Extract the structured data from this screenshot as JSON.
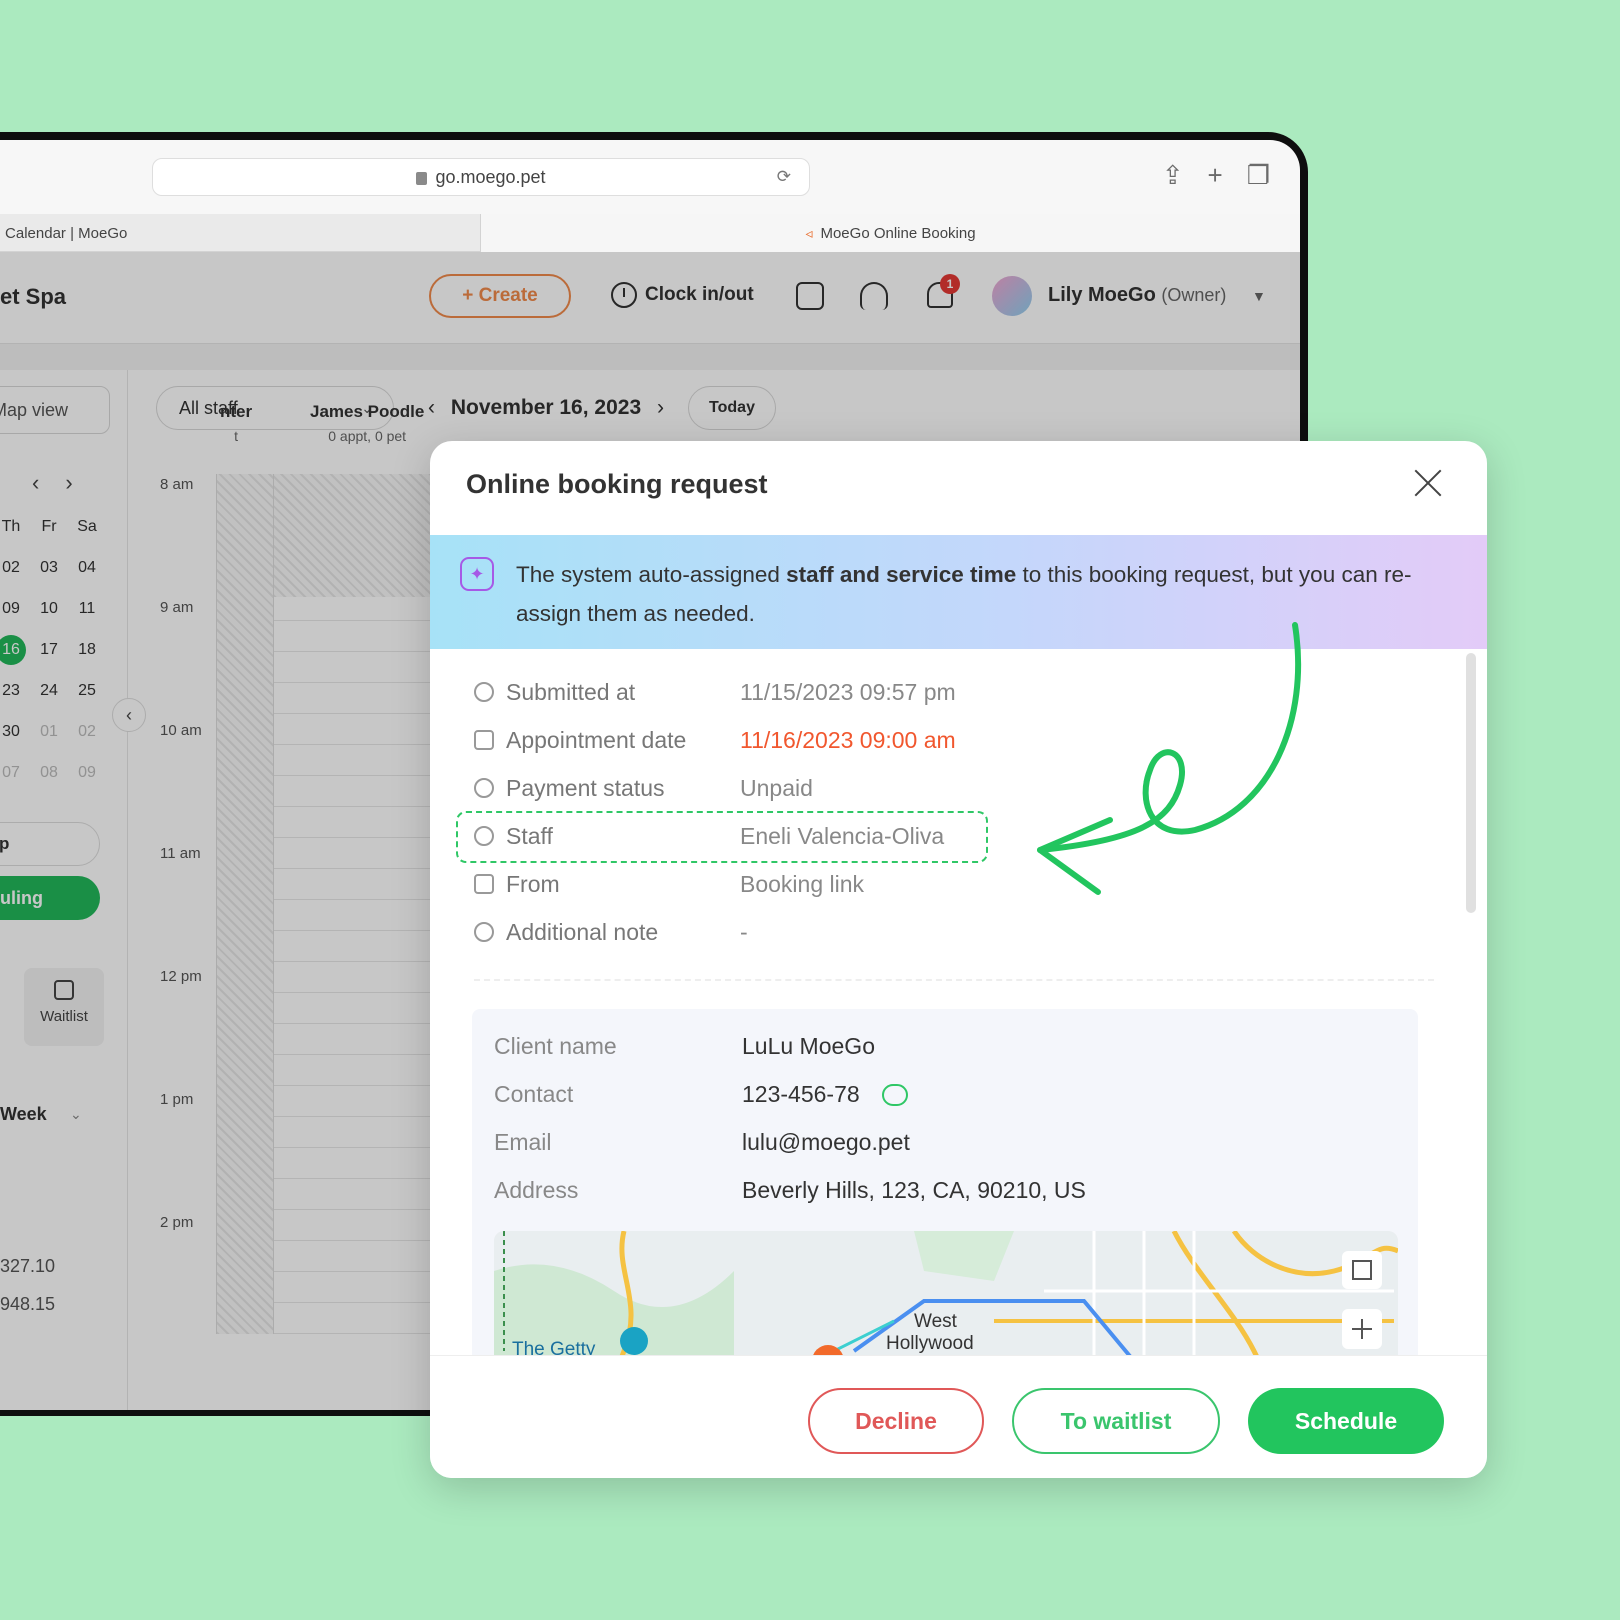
{
  "browser": {
    "url": "go.moego.pet",
    "tabs": [
      {
        "label": "Calendar | MoeGo"
      },
      {
        "label": "MoeGo Online Booking"
      }
    ]
  },
  "app": {
    "brand": "et Spa",
    "create_label": "+ Create",
    "clock_label": "Clock in/out",
    "notification_count": "1",
    "user_name": "Lily MoeGo",
    "user_role": "(Owner)"
  },
  "sidebar": {
    "map_view_label": "Map view",
    "weekdays": [
      "Th",
      "Fr",
      "Sa"
    ],
    "weeks": [
      [
        "02",
        "03",
        "04"
      ],
      [
        "09",
        "10",
        "11"
      ],
      [
        "16",
        "17",
        "18"
      ],
      [
        "23",
        "24",
        "25"
      ],
      [
        "30",
        "01",
        "02"
      ],
      [
        "07",
        "08",
        "09"
      ]
    ],
    "pill_label": "p",
    "green_label": "uling",
    "waitlist_label": "Waitlist",
    "week_label": "Week",
    "stat1": "327.10",
    "stat2": "948.15"
  },
  "calendar": {
    "staff_filter": "All staff",
    "date": "November 16, 2023",
    "today_label": "Today",
    "columns": [
      {
        "name": "nter",
        "sub": "t"
      },
      {
        "name": "James Poodle",
        "sub": "0 appt, 0 pet"
      }
    ],
    "times": [
      "8 am",
      "9 am",
      "10 am",
      "11 am",
      "12 pm",
      "1 pm",
      "2 pm"
    ]
  },
  "modal": {
    "title": "Online booking request",
    "banner_pre": "The system auto-assigned ",
    "banner_bold": "staff and service time",
    "banner_post": " to this booking request, but you can re-assign them as needed.",
    "details": [
      {
        "label": "Submitted at",
        "value": "11/15/2023 09:57 pm",
        "icon": "clock-icon"
      },
      {
        "label": "Appointment date",
        "value": "11/16/2023 09:00 am",
        "icon": "calendar-icon"
      },
      {
        "label": "Payment status",
        "value": "Unpaid",
        "icon": "dollar-icon"
      },
      {
        "label": "Staff",
        "value": "Eneli Valencia-Oliva",
        "icon": "person-icon"
      },
      {
        "label": "From",
        "value": "Booking link",
        "icon": "link-icon"
      },
      {
        "label": "Additional note",
        "value": "-",
        "icon": "info-icon"
      }
    ],
    "client": {
      "name_label": "Client name",
      "name": "LuLu MoeGo",
      "contact_label": "Contact",
      "contact": "123-456-78",
      "email_label": "Email",
      "email": "lulu@moego.pet",
      "address_label": "Address",
      "address": "Beverly Hills, 123, CA, 90210, US"
    },
    "map_labels": [
      "The Getty",
      "West",
      "Hollywood"
    ],
    "decline_label": "Decline",
    "waitlist_label": "To waitlist",
    "schedule_label": "Schedule",
    "colors": {
      "accent_green": "#22c55e",
      "danger": "#e05858",
      "date_red": "#f1572e",
      "create_orange": "#f08a4b"
    }
  }
}
